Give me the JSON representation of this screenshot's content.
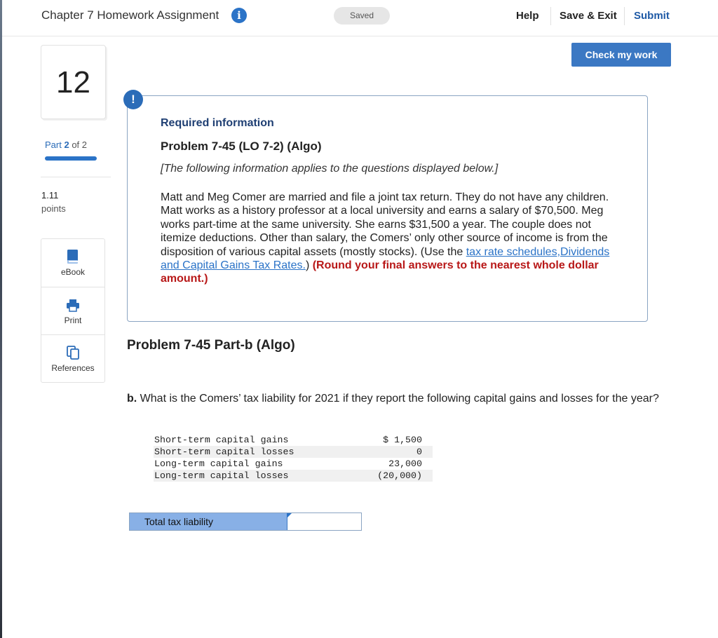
{
  "header": {
    "title": "Chapter 7 Homework Assignment",
    "saved_badge": "Saved",
    "help": "Help",
    "save_exit": "Save & Exit",
    "submit": "Submit"
  },
  "check_button": "Check my work",
  "question_number": "12",
  "part": {
    "prefix": "Part",
    "current": "2",
    "of_text": "of 2"
  },
  "points": {
    "value": "1.11",
    "label": "points"
  },
  "tools": [
    {
      "label": "eBook",
      "icon": "book-icon"
    },
    {
      "label": "Print",
      "icon": "printer-icon"
    },
    {
      "label": "References",
      "icon": "copy-icon"
    }
  ],
  "alert_icon": "!",
  "required": {
    "heading": "Required information",
    "problem_title": "Problem 7-45 (LO 7-2) (Algo)",
    "subtitle": "[The following information applies to the questions displayed below.]",
    "body_text": "Matt and Meg Comer are married and file a joint tax return. They do not have any children. Matt works as a history professor at a local university and earns a salary of $70,500. Meg works part-time at the same university. She earns $31,500 a year. The couple does not itemize deductions. Other than salary, the Comers’ only other source of income is from the disposition of various capital assets (mostly stocks). (Use the ",
    "link1": "tax rate schedules,",
    "link2": "Dividends and Capital Gains Tax Rates.",
    "after_links": ") ",
    "bold_red": "(Round your final answers to the nearest whole dollar amount.)"
  },
  "part_title": "Problem 7-45 Part-b (Algo)",
  "question": {
    "bold_prefix": "b.",
    "text": " What is the Comers’ tax liability for 2021 if they report the following capital gains and losses for the year?"
  },
  "capital_table": [
    {
      "label": "Short-term capital gains",
      "value": "$ 1,500"
    },
    {
      "label": "Short-term capital losses",
      "value": "0"
    },
    {
      "label": "Long-term capital gains",
      "value": "23,000"
    },
    {
      "label": "Long-term capital losses",
      "value": "(20,000)"
    }
  ],
  "answer": {
    "label": "Total tax liability",
    "value": ""
  }
}
